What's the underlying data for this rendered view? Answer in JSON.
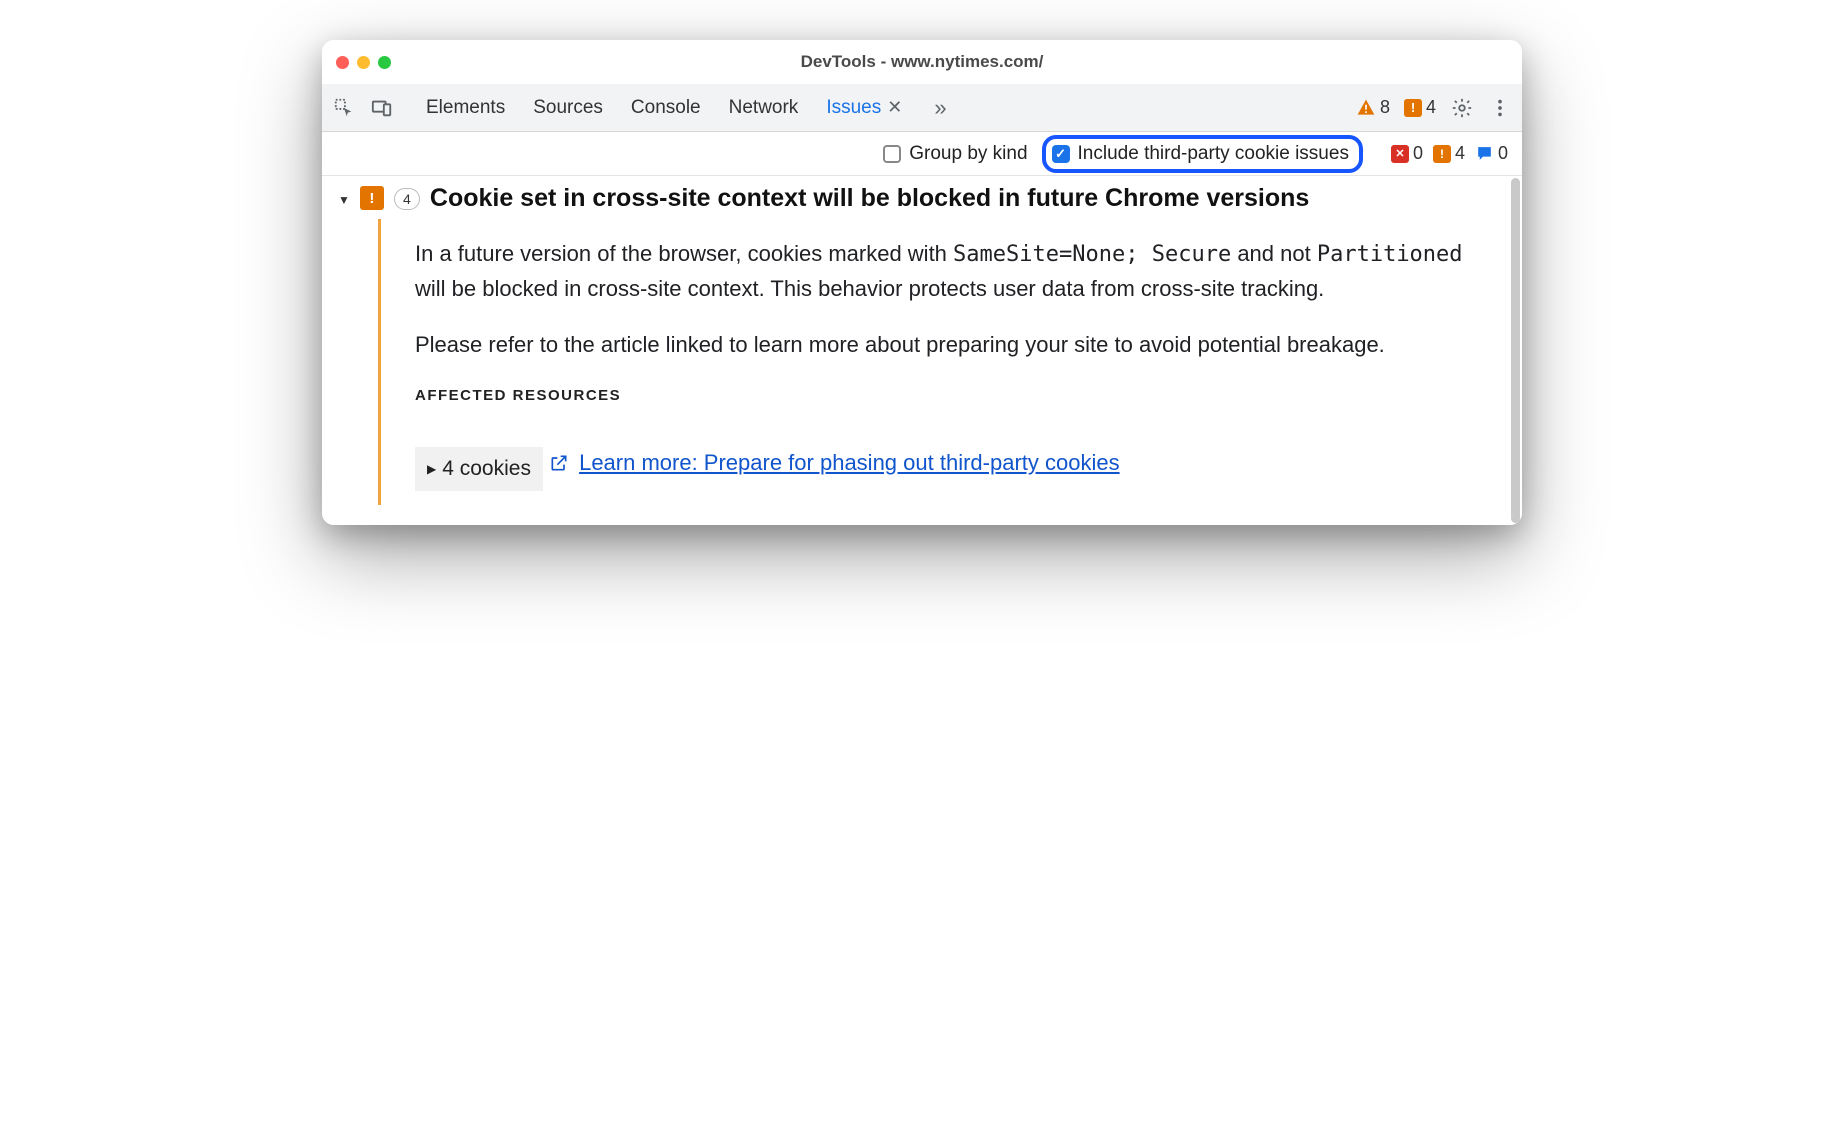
{
  "window": {
    "title": "DevTools - www.nytimes.com/"
  },
  "tabs": {
    "elements": "Elements",
    "sources": "Sources",
    "console": "Console",
    "network": "Network",
    "issues": "Issues"
  },
  "toolbar_counts": {
    "warnings": "8",
    "issues": "4"
  },
  "filters": {
    "group_by_kind": "Group by kind",
    "include_third_party": "Include third-party cookie issues"
  },
  "mini_counts": {
    "errors": "0",
    "warnings": "4",
    "info": "0"
  },
  "issue": {
    "count": "4",
    "title": "Cookie set in cross-site context will be blocked in future Chrome versions",
    "para1_pre": "In a future version of the browser, cookies marked with ",
    "code1": "SameSite=None; Secure",
    "para1_mid": " and not ",
    "code2": "Partitioned",
    "para1_post": " will be blocked in cross-site context. This behavior protects user data from cross-site tracking.",
    "para2": "Please refer to the article linked to learn more about preparing your site to avoid potential breakage.",
    "affected_heading": "AFFECTED RESOURCES",
    "cookies_label": "4 cookies",
    "learn_more": "Learn more: Prepare for phasing out third-party cookies"
  }
}
